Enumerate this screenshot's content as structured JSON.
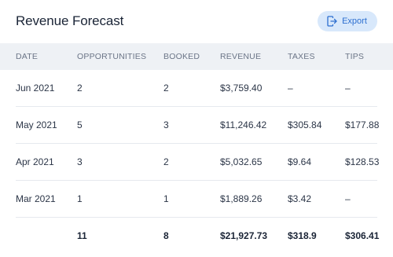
{
  "header": {
    "title": "Revenue Forecast",
    "export_label": "Export",
    "export_icon": "export-icon",
    "accent_color": "#2d6fd0",
    "button_bg": "#d8e8fb"
  },
  "table": {
    "columns": [
      "DATE",
      "OPPORTUNITIES",
      "BOOKED",
      "REVENUE",
      "TAXES",
      "TIPS"
    ],
    "rows": [
      {
        "date": "Jun 2021",
        "opportunities": "2",
        "booked": "2",
        "revenue": "$3,759.40",
        "taxes": "–",
        "tips": "–"
      },
      {
        "date": "May 2021",
        "opportunities": "5",
        "booked": "3",
        "revenue": "$11,246.42",
        "taxes": "$305.84",
        "tips": "$177.88"
      },
      {
        "date": "Apr 2021",
        "opportunities": "3",
        "booked": "2",
        "revenue": "$5,032.65",
        "taxes": "$9.64",
        "tips": "$128.53"
      },
      {
        "date": "Mar 2021",
        "opportunities": "1",
        "booked": "1",
        "revenue": "$1,889.26",
        "taxes": "$3.42",
        "tips": "–"
      }
    ],
    "totals": {
      "date": "",
      "opportunities": "11",
      "booked": "8",
      "revenue": "$21,927.73",
      "taxes": "$318.9",
      "tips": "$306.41"
    }
  }
}
